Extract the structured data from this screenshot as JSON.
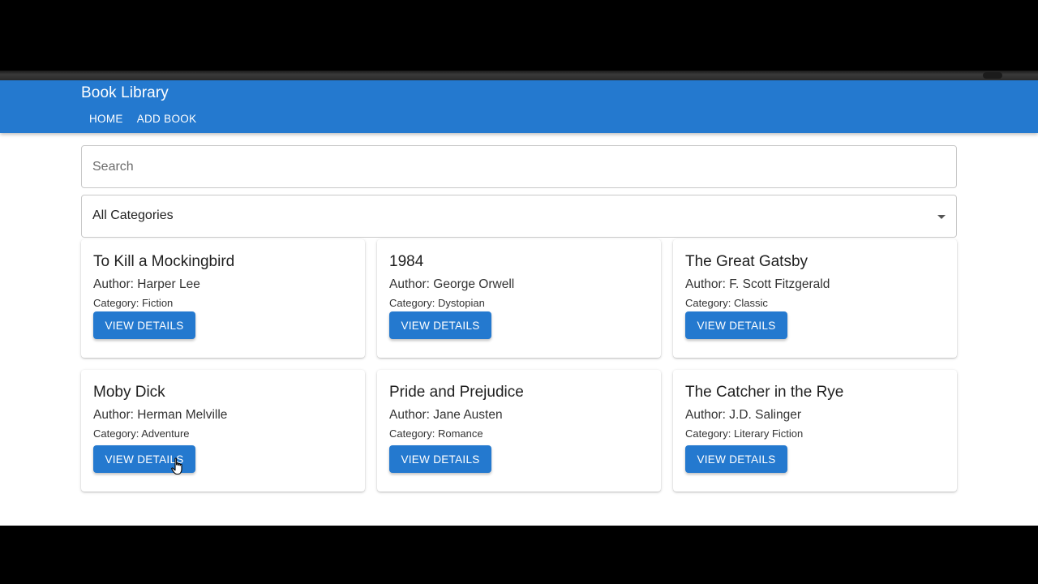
{
  "app": {
    "title": "Book Library"
  },
  "nav": {
    "items": [
      {
        "label": "HOME"
      },
      {
        "label": "ADD BOOK"
      }
    ]
  },
  "search": {
    "placeholder": "Search",
    "value": ""
  },
  "category_filter": {
    "selected": "All Categories"
  },
  "labels": {
    "author_prefix": "Author: ",
    "category_prefix": "Category: "
  },
  "books": [
    {
      "title": "To Kill a Mockingbird",
      "author": "Harper Lee",
      "category": "Fiction",
      "button": "VIEW DETAILS"
    },
    {
      "title": "1984",
      "author": "George Orwell",
      "category": "Dystopian",
      "button": "VIEW DETAILS"
    },
    {
      "title": "The Great Gatsby",
      "author": "F. Scott Fitzgerald",
      "category": "Classic",
      "button": "VIEW DETAILS"
    },
    {
      "title": "Moby Dick",
      "author": "Herman Melville",
      "category": "Adventure",
      "button": "VIEW DETAILS"
    },
    {
      "title": "Pride and Prejudice",
      "author": "Jane Austen",
      "category": "Romance",
      "button": "VIEW DETAILS"
    },
    {
      "title": "The Catcher in the Rye",
      "author": "J.D. Salinger",
      "category": "Literary Fiction",
      "button": "VIEW DETAILS"
    }
  ],
  "colors": {
    "primary": "#2479cf",
    "background": "#ffffff",
    "letterbox": "#000000"
  },
  "icons": {
    "select": "chevron-down-icon",
    "pointer": "hand-cursor-icon"
  }
}
